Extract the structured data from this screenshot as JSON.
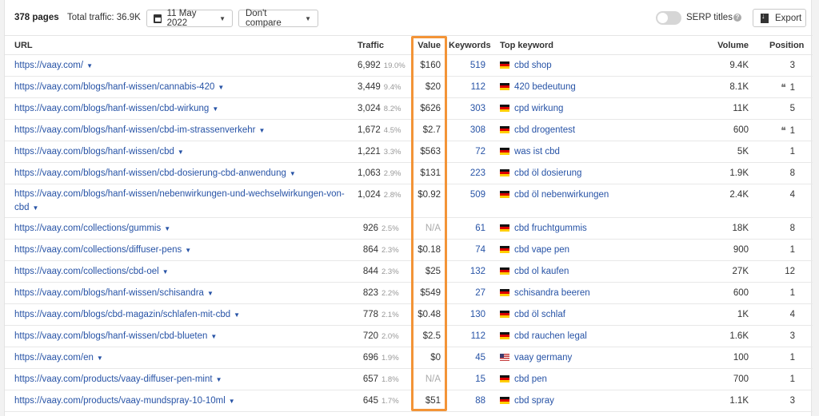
{
  "toolbar": {
    "pages_count": "378 pages",
    "total_traffic": "Total traffic: 36.9K",
    "date": "11 May 2022",
    "compare": "Don't compare",
    "serp_titles_label": "SERP titles",
    "serp_titles_enabled": false,
    "export_label": "Export"
  },
  "table": {
    "columns": {
      "url": "URL",
      "traffic": "Traffic",
      "value": "Value",
      "keywords": "Keywords",
      "top_keyword": "Top keyword",
      "volume": "Volume",
      "position": "Position"
    },
    "rows": [
      {
        "url": "https://vaay.com/",
        "traffic": "6,992",
        "pct": "19.0%",
        "value": "$160",
        "keywords": "519",
        "flag": "de",
        "top_keyword": "cbd shop",
        "volume": "9.4K",
        "quote": "",
        "position": "3"
      },
      {
        "url": "https://vaay.com/blogs/hanf-wissen/cannabis-420",
        "traffic": "3,449",
        "pct": "9.4%",
        "value": "$20",
        "keywords": "112",
        "flag": "de",
        "top_keyword": "420 bedeutung",
        "volume": "8.1K",
        "quote": "❛❛",
        "position": "1"
      },
      {
        "url": "https://vaay.com/blogs/hanf-wissen/cbd-wirkung",
        "traffic": "3,024",
        "pct": "8.2%",
        "value": "$626",
        "keywords": "303",
        "flag": "de",
        "top_keyword": "cpd wirkung",
        "volume": "11K",
        "quote": "",
        "position": "5"
      },
      {
        "url": "https://vaay.com/blogs/hanf-wissen/cbd-im-strassenverkehr",
        "traffic": "1,672",
        "pct": "4.5%",
        "value": "$2.7",
        "keywords": "308",
        "flag": "de",
        "top_keyword": "cbd drogentest",
        "volume": "600",
        "quote": "❛❛",
        "position": "1"
      },
      {
        "url": "https://vaay.com/blogs/hanf-wissen/cbd",
        "traffic": "1,221",
        "pct": "3.3%",
        "value": "$563",
        "keywords": "72",
        "flag": "de",
        "top_keyword": "was ist cbd",
        "volume": "5K",
        "quote": "",
        "position": "1"
      },
      {
        "url": "https://vaay.com/blogs/hanf-wissen/cbd-dosierung-cbd-anwendung",
        "traffic": "1,063",
        "pct": "2.9%",
        "value": "$131",
        "keywords": "223",
        "flag": "de",
        "top_keyword": "cbd öl dosierung",
        "volume": "1.9K",
        "quote": "",
        "position": "8"
      },
      {
        "url": "https://vaay.com/blogs/hanf-wissen/nebenwirkungen-und-wechselwirkungen-von-cbd",
        "traffic": "1,024",
        "pct": "2.8%",
        "value": "$0.92",
        "keywords": "509",
        "flag": "de",
        "top_keyword": "cbd öl nebenwirkungen",
        "volume": "2.4K",
        "quote": "",
        "position": "4"
      },
      {
        "url": "https://vaay.com/collections/gummis",
        "traffic": "926",
        "pct": "2.5%",
        "value": "N/A",
        "keywords": "61",
        "flag": "de",
        "top_keyword": "cbd fruchtgummis",
        "volume": "18K",
        "quote": "",
        "position": "8"
      },
      {
        "url": "https://vaay.com/collections/diffuser-pens",
        "traffic": "864",
        "pct": "2.3%",
        "value": "$0.18",
        "keywords": "74",
        "flag": "de",
        "top_keyword": "cbd vape pen",
        "volume": "900",
        "quote": "",
        "position": "1"
      },
      {
        "url": "https://vaay.com/collections/cbd-oel",
        "traffic": "844",
        "pct": "2.3%",
        "value": "$25",
        "keywords": "132",
        "flag": "de",
        "top_keyword": "cbd ol kaufen",
        "volume": "27K",
        "quote": "",
        "position": "12"
      },
      {
        "url": "https://vaay.com/blogs/hanf-wissen/schisandra",
        "traffic": "823",
        "pct": "2.2%",
        "value": "$549",
        "keywords": "27",
        "flag": "de",
        "top_keyword": "schisandra beeren",
        "volume": "600",
        "quote": "",
        "position": "1"
      },
      {
        "url": "https://vaay.com/blogs/cbd-magazin/schlafen-mit-cbd",
        "traffic": "778",
        "pct": "2.1%",
        "value": "$0.48",
        "keywords": "130",
        "flag": "de",
        "top_keyword": "cbd öl schlaf",
        "volume": "1K",
        "quote": "",
        "position": "4"
      },
      {
        "url": "https://vaay.com/blogs/hanf-wissen/cbd-blueten",
        "traffic": "720",
        "pct": "2.0%",
        "value": "$2.5",
        "keywords": "112",
        "flag": "de",
        "top_keyword": "cbd rauchen legal",
        "volume": "1.6K",
        "quote": "",
        "position": "3"
      },
      {
        "url": "https://vaay.com/en",
        "traffic": "696",
        "pct": "1.9%",
        "value": "$0",
        "keywords": "45",
        "flag": "us",
        "top_keyword": "vaay germany",
        "volume": "100",
        "quote": "",
        "position": "1"
      },
      {
        "url": "https://vaay.com/products/vaay-diffuser-pen-mint",
        "traffic": "657",
        "pct": "1.8%",
        "value": "N/A",
        "keywords": "15",
        "flag": "de",
        "top_keyword": "cbd pen",
        "volume": "700",
        "quote": "",
        "position": "1"
      },
      {
        "url": "https://vaay.com/products/vaay-mundspray-10-10ml",
        "traffic": "645",
        "pct": "1.7%",
        "value": "$51",
        "keywords": "88",
        "flag": "de",
        "top_keyword": "cbd spray",
        "volume": "1.1K",
        "quote": "",
        "position": "3"
      }
    ]
  },
  "colors": {
    "link": "#2753a6",
    "highlight": "#f39437"
  }
}
